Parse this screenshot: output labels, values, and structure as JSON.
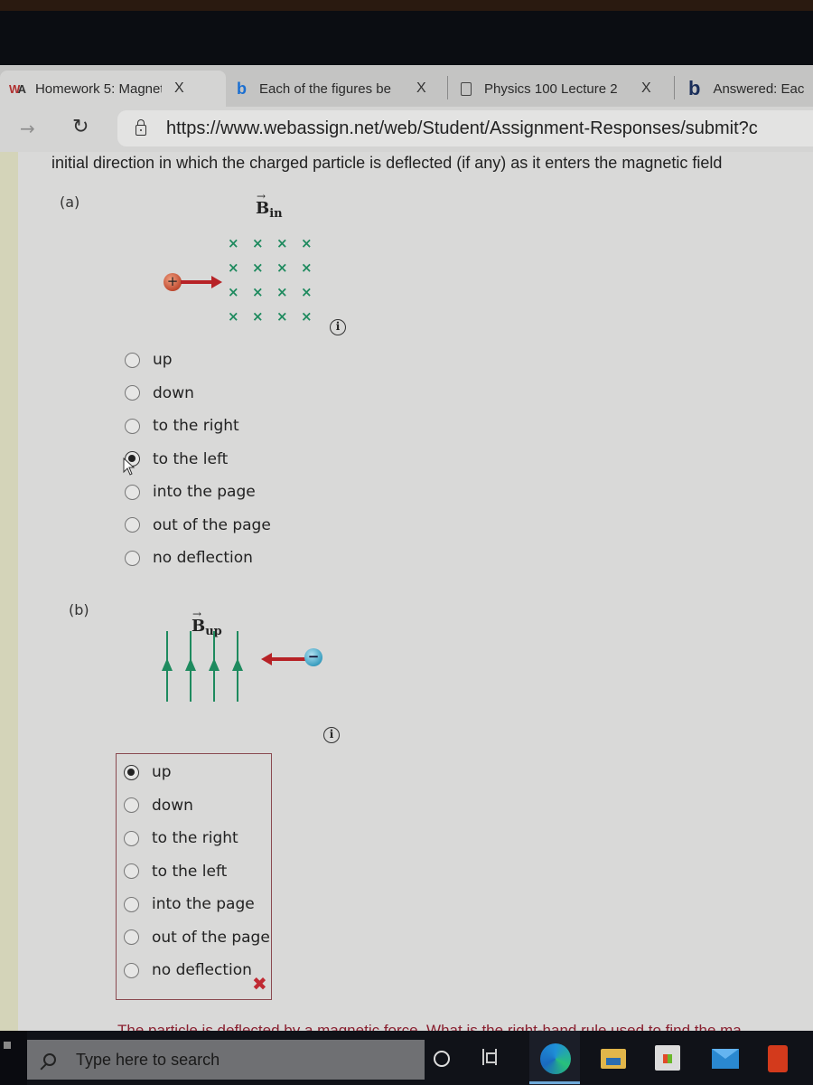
{
  "browser": {
    "tabs": [
      {
        "icon": "webassign-icon",
        "title": "Homework 5: Magnet",
        "active": true,
        "close": "X"
      },
      {
        "icon": "bing-icon",
        "title": "Each of the figures be",
        "active": false,
        "close": "X"
      },
      {
        "icon": "document-icon",
        "title": "Physics 100 Lecture 2",
        "active": false,
        "close": "X"
      },
      {
        "icon": "bing-icon",
        "title": "Answered: Eac",
        "active": false,
        "close": ""
      }
    ],
    "url": "https://www.webassign.net/web/Student/Assignment-Responses/submit?c"
  },
  "question": {
    "prompt": "initial direction in which the charged particle is deflected (if any) as it enters the magnetic field",
    "parts": [
      {
        "label": "(a)",
        "figure": {
          "field_symbol": "B",
          "field_subscript": "in",
          "field_direction": "into the page",
          "particle_charge": "+",
          "particle_motion": "right",
          "grid_rows": 4,
          "grid_cols": 4
        },
        "options": [
          "up",
          "down",
          "to the right",
          "to the left",
          "into the page",
          "out of the page",
          "no deflection"
        ],
        "selected": "to the left",
        "graded": false
      },
      {
        "label": "(b)",
        "figure": {
          "field_symbol": "B",
          "field_subscript": "up",
          "field_direction": "up",
          "particle_charge": "−",
          "particle_motion": "left",
          "field_lines": 4
        },
        "options": [
          "up",
          "down",
          "to the right",
          "to the left",
          "into the page",
          "out of the page",
          "no deflection"
        ],
        "selected": "up",
        "graded": true,
        "result": "incorrect",
        "result_icon": "✖"
      }
    ],
    "feedback": "The particle is deflected by a magnetic force. What is the right-hand rule used to find the ma"
  },
  "taskbar": {
    "search_placeholder": "Type here to search",
    "apps": [
      "cortana",
      "task-view",
      "edge",
      "file-explorer",
      "microsoft-store",
      "mail",
      "office"
    ]
  },
  "colors": {
    "field": "#1e8a5e",
    "arrow": "#b72226",
    "incorrect": "#c02a33",
    "feedback": "#8a2030"
  }
}
